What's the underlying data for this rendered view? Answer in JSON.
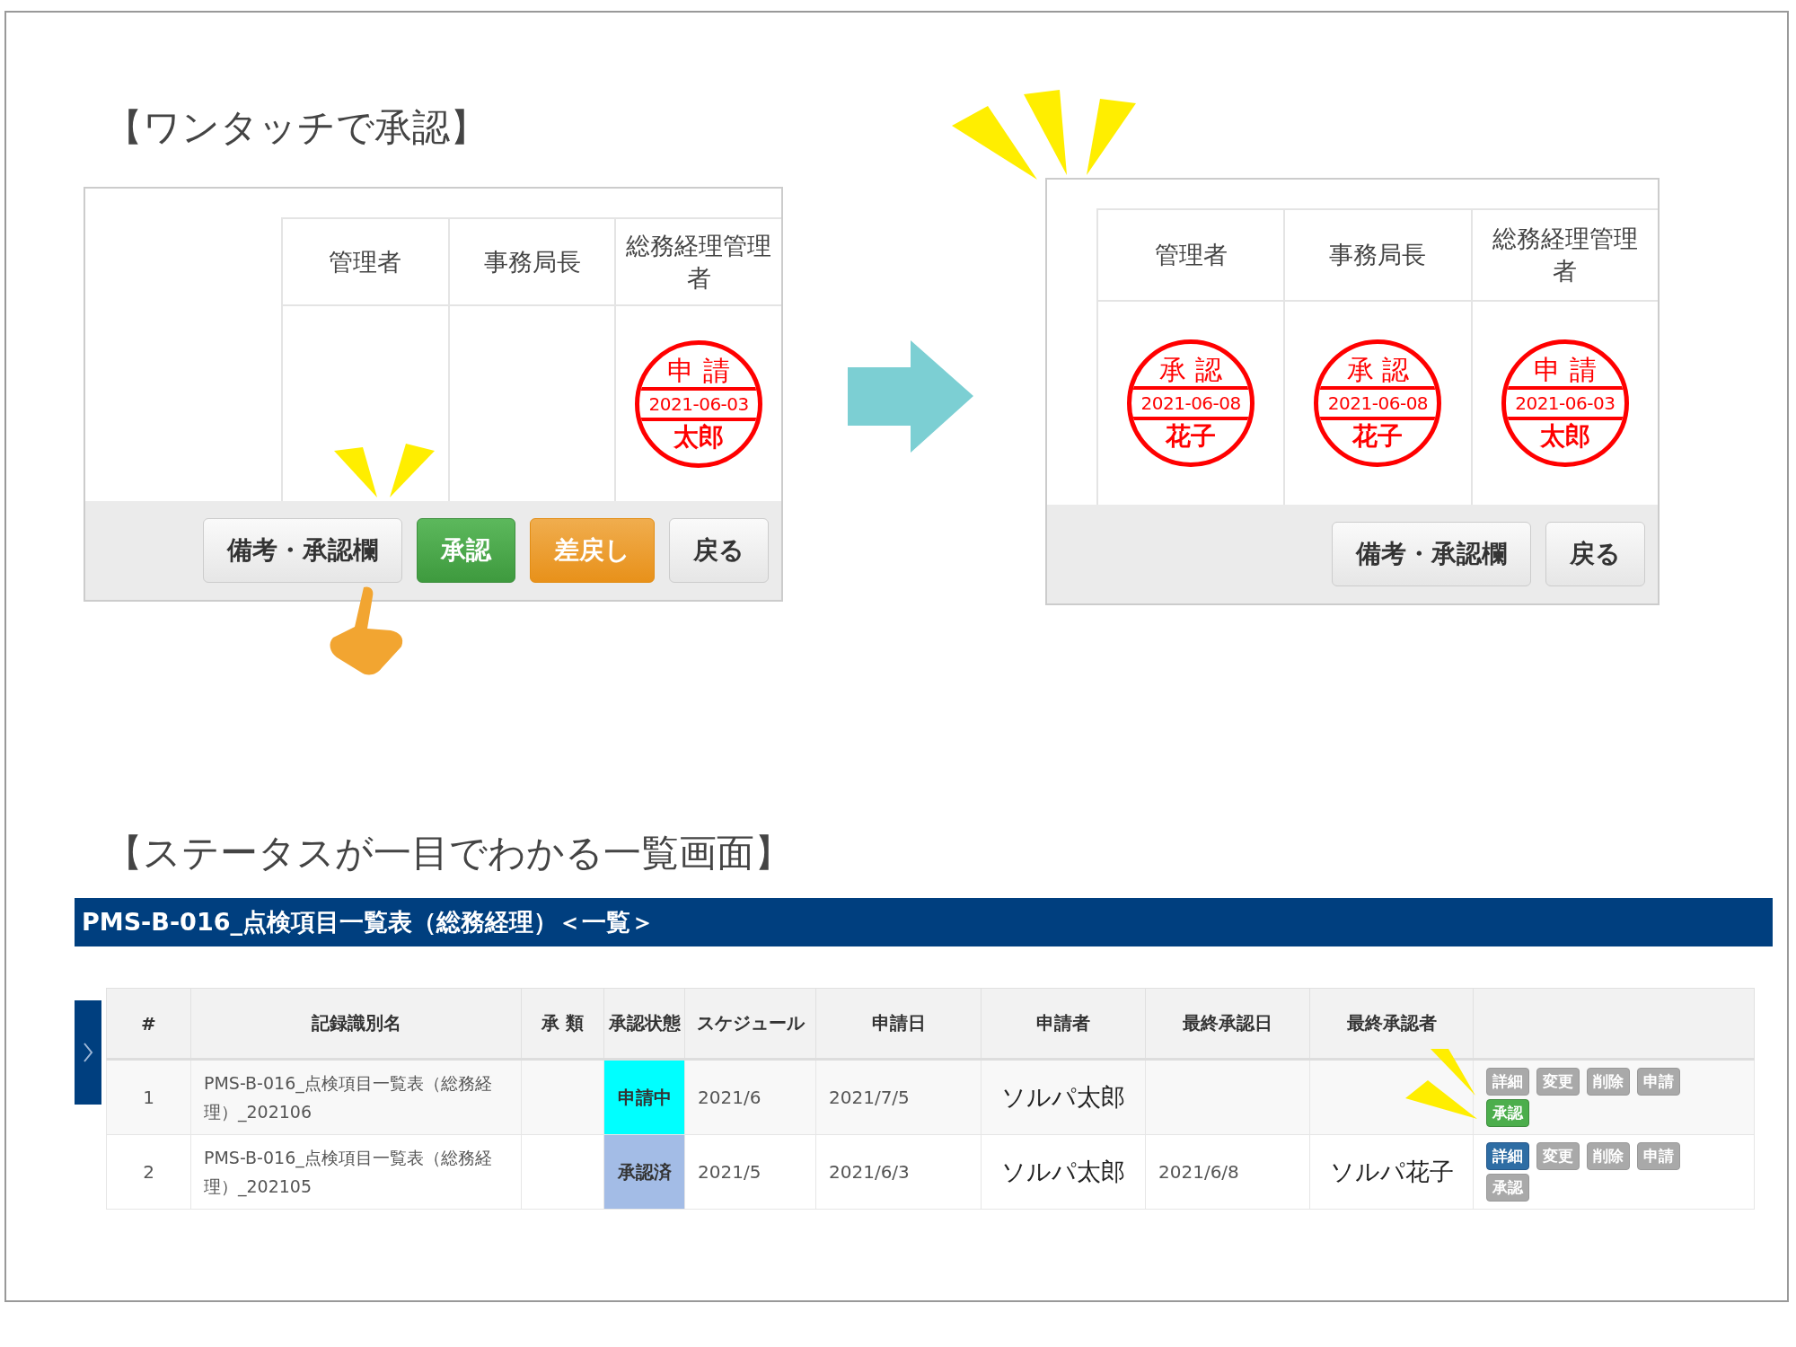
{
  "one_touch": {
    "title": "【ワンタッチで承認】",
    "before": {
      "columns": [
        {
          "label": "管理者"
        },
        {
          "label": "事務局長"
        },
        {
          "label": "総務経理管理者",
          "seal": {
            "label": "申 請",
            "date": "2021-06-03",
            "name": "太郎"
          }
        }
      ],
      "buttons": [
        {
          "label": "備考・承認欄",
          "kind": "default"
        },
        {
          "label": "承認",
          "kind": "success"
        },
        {
          "label": "差戻し",
          "kind": "warning"
        },
        {
          "label": "戻る",
          "kind": "default"
        }
      ]
    },
    "after": {
      "columns": [
        {
          "label": "管理者",
          "seal": {
            "label": "承 認",
            "date": "2021-06-08",
            "name": "花子"
          }
        },
        {
          "label": "事務局長",
          "seal": {
            "label": "承 認",
            "date": "2021-06-08",
            "name": "花子"
          }
        },
        {
          "label": "総務経理管理者",
          "seal": {
            "label": "申 請",
            "date": "2021-06-03",
            "name": "太郎"
          }
        }
      ],
      "buttons": [
        {
          "label": "備考・承認欄",
          "kind": "default"
        },
        {
          "label": "戻る",
          "kind": "default"
        }
      ]
    }
  },
  "list_screen": {
    "title": "【ステータスが一目でわかる一覧画面】",
    "header": "PMS-B-016_点検項目一覧表（総務経理）＜一覧＞",
    "table": {
      "columns": [
        "#",
        "記録識別名",
        "承 類",
        "承認状態",
        "スケジュール",
        "申請日",
        "申請者",
        "最終承認日",
        "最終承認者"
      ],
      "rows": [
        {
          "num": "1",
          "name": "PMS-B-016_点検項目一覧表（総務経理）_202106",
          "status": {
            "label": "申請中",
            "color": "#00ffff"
          },
          "schedule": "2021/6",
          "applied": "2021/7/5",
          "applicant": "ソルパ太郎",
          "actions": [
            {
              "label": "詳細",
              "kind": "muted"
            },
            {
              "label": "変更",
              "kind": "muted"
            },
            {
              "label": "削除",
              "kind": "muted"
            },
            {
              "label": "申請",
              "kind": "muted"
            },
            {
              "label": "承認",
              "kind": "success"
            }
          ]
        },
        {
          "num": "2",
          "name": "PMS-B-016_点検項目一覧表（総務経理）_202105",
          "status": {
            "label": "承認済",
            "color": "#a3bce6"
          },
          "schedule": "2021/5",
          "applied": "2021/6/3",
          "applicant": "ソルパ太郎",
          "last_date": "2021/6/8",
          "last_approver": "ソルパ花子",
          "actions": [
            {
              "label": "詳細",
              "kind": "primary"
            },
            {
              "label": "変更",
              "kind": "muted"
            },
            {
              "label": "削除",
              "kind": "muted"
            },
            {
              "label": "申請",
              "kind": "muted"
            },
            {
              "label": "承認",
              "kind": "muted"
            }
          ]
        }
      ]
    }
  }
}
